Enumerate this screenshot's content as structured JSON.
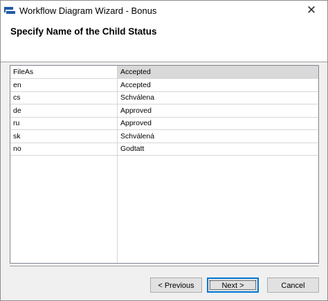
{
  "window": {
    "title": "Workflow Diagram Wizard - Bonus",
    "close_label": "✕"
  },
  "header": {
    "title": "Specify Name of the Child Status"
  },
  "grid": {
    "rows": [
      {
        "key": "FileAs",
        "value": "Accepted",
        "selected": true
      },
      {
        "key": "en",
        "value": "Accepted"
      },
      {
        "key": "cs",
        "value": "Schválena"
      },
      {
        "key": "de",
        "value": "Approved"
      },
      {
        "key": "ru",
        "value": "Approved"
      },
      {
        "key": "sk",
        "value": "Schválená"
      },
      {
        "key": "no",
        "value": "Godtatt"
      }
    ]
  },
  "buttons": {
    "previous": "< Previous",
    "next": "Next >",
    "cancel": "Cancel"
  },
  "colors": {
    "icon_blue": "#1f5aa6",
    "selection": "#d9d9d9",
    "default_button_border": "#0078d7"
  }
}
